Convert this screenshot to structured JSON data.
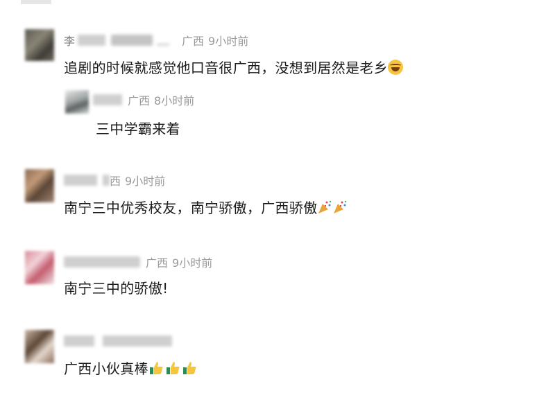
{
  "comments": [
    {
      "location": "广西",
      "time": "9小时前",
      "text": "追剧的时候就感觉他口音很广西，没想到居然是老乡",
      "emoji": "laughing-tears-icon",
      "replies": [
        {
          "location": "广西",
          "time": "8小时前",
          "text": "三中学霸来着"
        }
      ]
    },
    {
      "location": "西",
      "time": "9小时前",
      "text": "南宁三中优秀校友，南宁骄傲，广西骄傲",
      "emoji": "party-popper-icon"
    },
    {
      "location": "广西",
      "time": "9小时前",
      "text": "南宁三中的骄傲!"
    },
    {
      "location": "",
      "time": "",
      "text": "广西小伙真棒",
      "emoji": "thumbs-up-icon"
    }
  ],
  "colors": {
    "meta": "#9a9a9a",
    "text": "#1a1a1a",
    "blur": "#cfcfcf"
  }
}
